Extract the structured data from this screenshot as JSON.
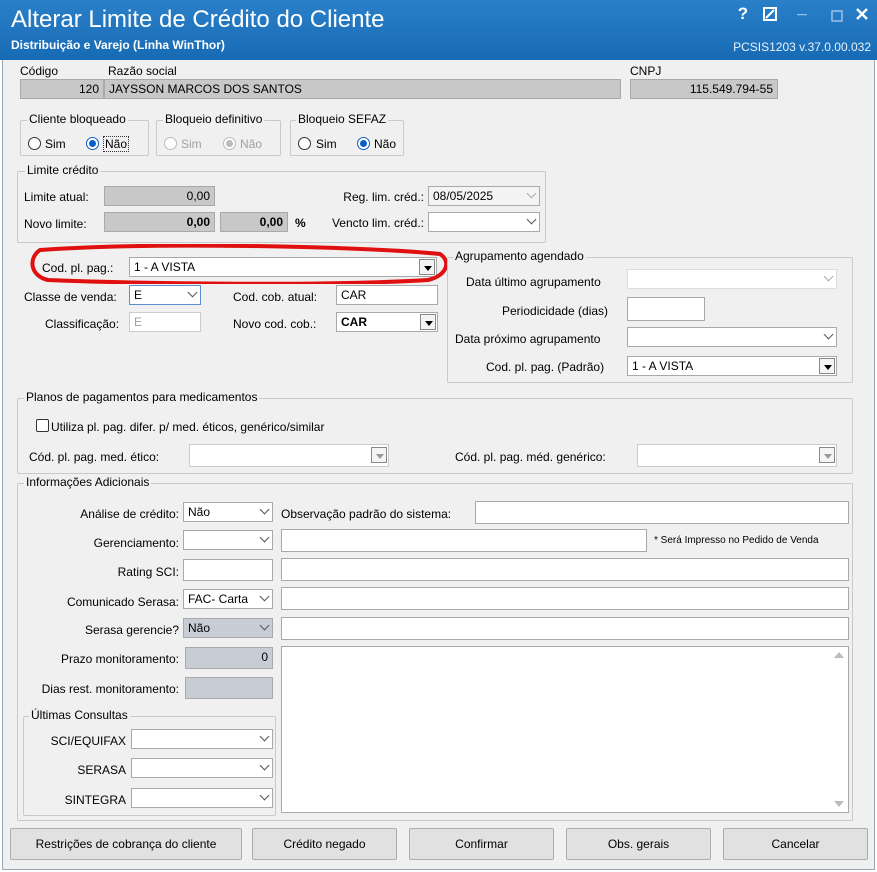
{
  "window": {
    "title": "Alterar Limite de Crédito do Cliente",
    "subtitle": "Distribuição e Varejo (Linha WinThor)",
    "code": "PCSIS1203  v.37.0.00.032",
    "help_label": "?"
  },
  "client": {
    "codigo_label": "Código",
    "codigo_value": "120",
    "razao_label": "Razão social",
    "razao_value": "JAYSSON MARCOS DOS SANTOS",
    "cnpj_label": "CNPJ",
    "cnpj_value": "115.549.794-55"
  },
  "bloqueios": {
    "cliente_bloqueado": {
      "title": "Cliente bloqueado",
      "sim": "Sim",
      "nao": "Não",
      "selected": "Não"
    },
    "bloqueio_definitivo": {
      "title": "Bloqueio definitivo",
      "sim": "Sim",
      "nao": "Não",
      "selected": "Não"
    },
    "bloqueio_sefaz": {
      "title": "Bloqueio SEFAZ",
      "sim": "Sim",
      "nao": "Não",
      "selected": "Não"
    }
  },
  "limite": {
    "title": "Limite crédito",
    "atual_label": "Limite atual:",
    "atual_value": "0,00",
    "novo_label": "Novo limite:",
    "novo_value": "0,00",
    "novo_pct": "0,00",
    "pct_symbol": "%",
    "reg_label": "Reg. lim. créd.:",
    "reg_value": "08/05/2025",
    "vencto_label": "Vencto lim. créd.:",
    "vencto_value": ""
  },
  "pagamento": {
    "cod_pl_label": "Cod. pl. pag.:",
    "cod_pl_value": "1 - A VISTA",
    "classe_label": "Classe de venda:",
    "classe_value": "E",
    "classificacao_label": "Classificação:",
    "classificacao_value": "E",
    "cob_atual_label": "Cod. cob. atual:",
    "cob_atual_value": "CAR",
    "novo_cob_label": "Novo cod. cob.:",
    "novo_cob_value": "CAR"
  },
  "agrupamento": {
    "title": "Agrupamento agendado",
    "ultimo_label": "Data último agrupamento",
    "ultimo_value": "",
    "periodicidade_label": "Periodicidade (dias)",
    "periodicidade_value": "",
    "proximo_label": "Data próximo agrupamento",
    "proximo_value": "",
    "padrao_label": "Cod. pl. pag. (Padrão)",
    "padrao_value": "1 - A VISTA"
  },
  "medicamentos": {
    "title": "Planos de pagamentos para medicamentos",
    "checkbox_label": "Utiliza pl. pag. difer. p/ med. éticos, genérico/similar",
    "etico_label": "Cód. pl. pag. med. ético:",
    "etico_value": "",
    "generico_label": "Cód. pl. pag. méd. genérico:",
    "generico_value": ""
  },
  "adicionais": {
    "title": "Informações Adicionais",
    "analise_label": "Análise de crédito:",
    "analise_value": "Não",
    "obs_label": "Observação padrão do sistema:",
    "obs_value": "",
    "gerenciamento_label": "Gerenciamento:",
    "gerenciamento_value": "",
    "impresso_note": "* Será Impresso no Pedido de Venda",
    "rating_label": "Rating SCI:",
    "rating_value": "",
    "comunicado_label": "Comunicado Serasa:",
    "comunicado_value": "FAC- Carta",
    "serasa_ger_label": "Serasa gerencie?",
    "serasa_ger_value": "Não",
    "prazo_label": "Prazo monitoramento:",
    "prazo_value": "0",
    "dias_label": "Dias rest. monitoramento:",
    "dias_value": ""
  },
  "consultas": {
    "title": "Últimas Consultas",
    "sci_label": "SCI/EQUIFAX",
    "serasa_label": "SERASA",
    "sintegra_label": "SINTEGRA"
  },
  "buttons": {
    "restricoes": "Restrições de cobrança do cliente",
    "credito_negado": "Crédito negado",
    "confirmar": "Confirmar",
    "obs_gerais": "Obs. gerais",
    "cancelar": "Cancelar"
  },
  "colors": {
    "titlebar": "#1e73be",
    "highlight_ellipse": "#e01010",
    "radio_selected": "#0a5ec8"
  }
}
